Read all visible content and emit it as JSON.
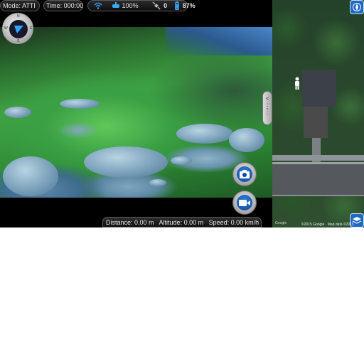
{
  "status": {
    "mode_label": "Mode: ATTI",
    "time_label": "Time: 000:00",
    "wifi_signal": "100%",
    "satellite_count": "0",
    "battery": "87%"
  },
  "compass": {
    "north": "N",
    "south": "S",
    "east": "E",
    "west": "W"
  },
  "telemetry": {
    "distance": "Distance: 0.00 m",
    "altitude": "Altitude: 0.00 m",
    "speed": "Speed: 0.00 km/h"
  },
  "map": {
    "google_logo": "Google",
    "attribution": "©2015 Google · Map data ©2015"
  },
  "icons": {
    "wifi": "wifi-icon",
    "remote": "remote-controller-icon",
    "satellite": "satellite-icon",
    "battery": "battery-icon",
    "camera": "camera-icon",
    "video": "video-camera-icon",
    "pegman": "street-view-pegman-icon",
    "compass": "compass-icon",
    "layers": "map-layers-icon"
  },
  "colors": {
    "accent_blue": "#1f68c4",
    "status_blue": "#3aa8ff"
  }
}
